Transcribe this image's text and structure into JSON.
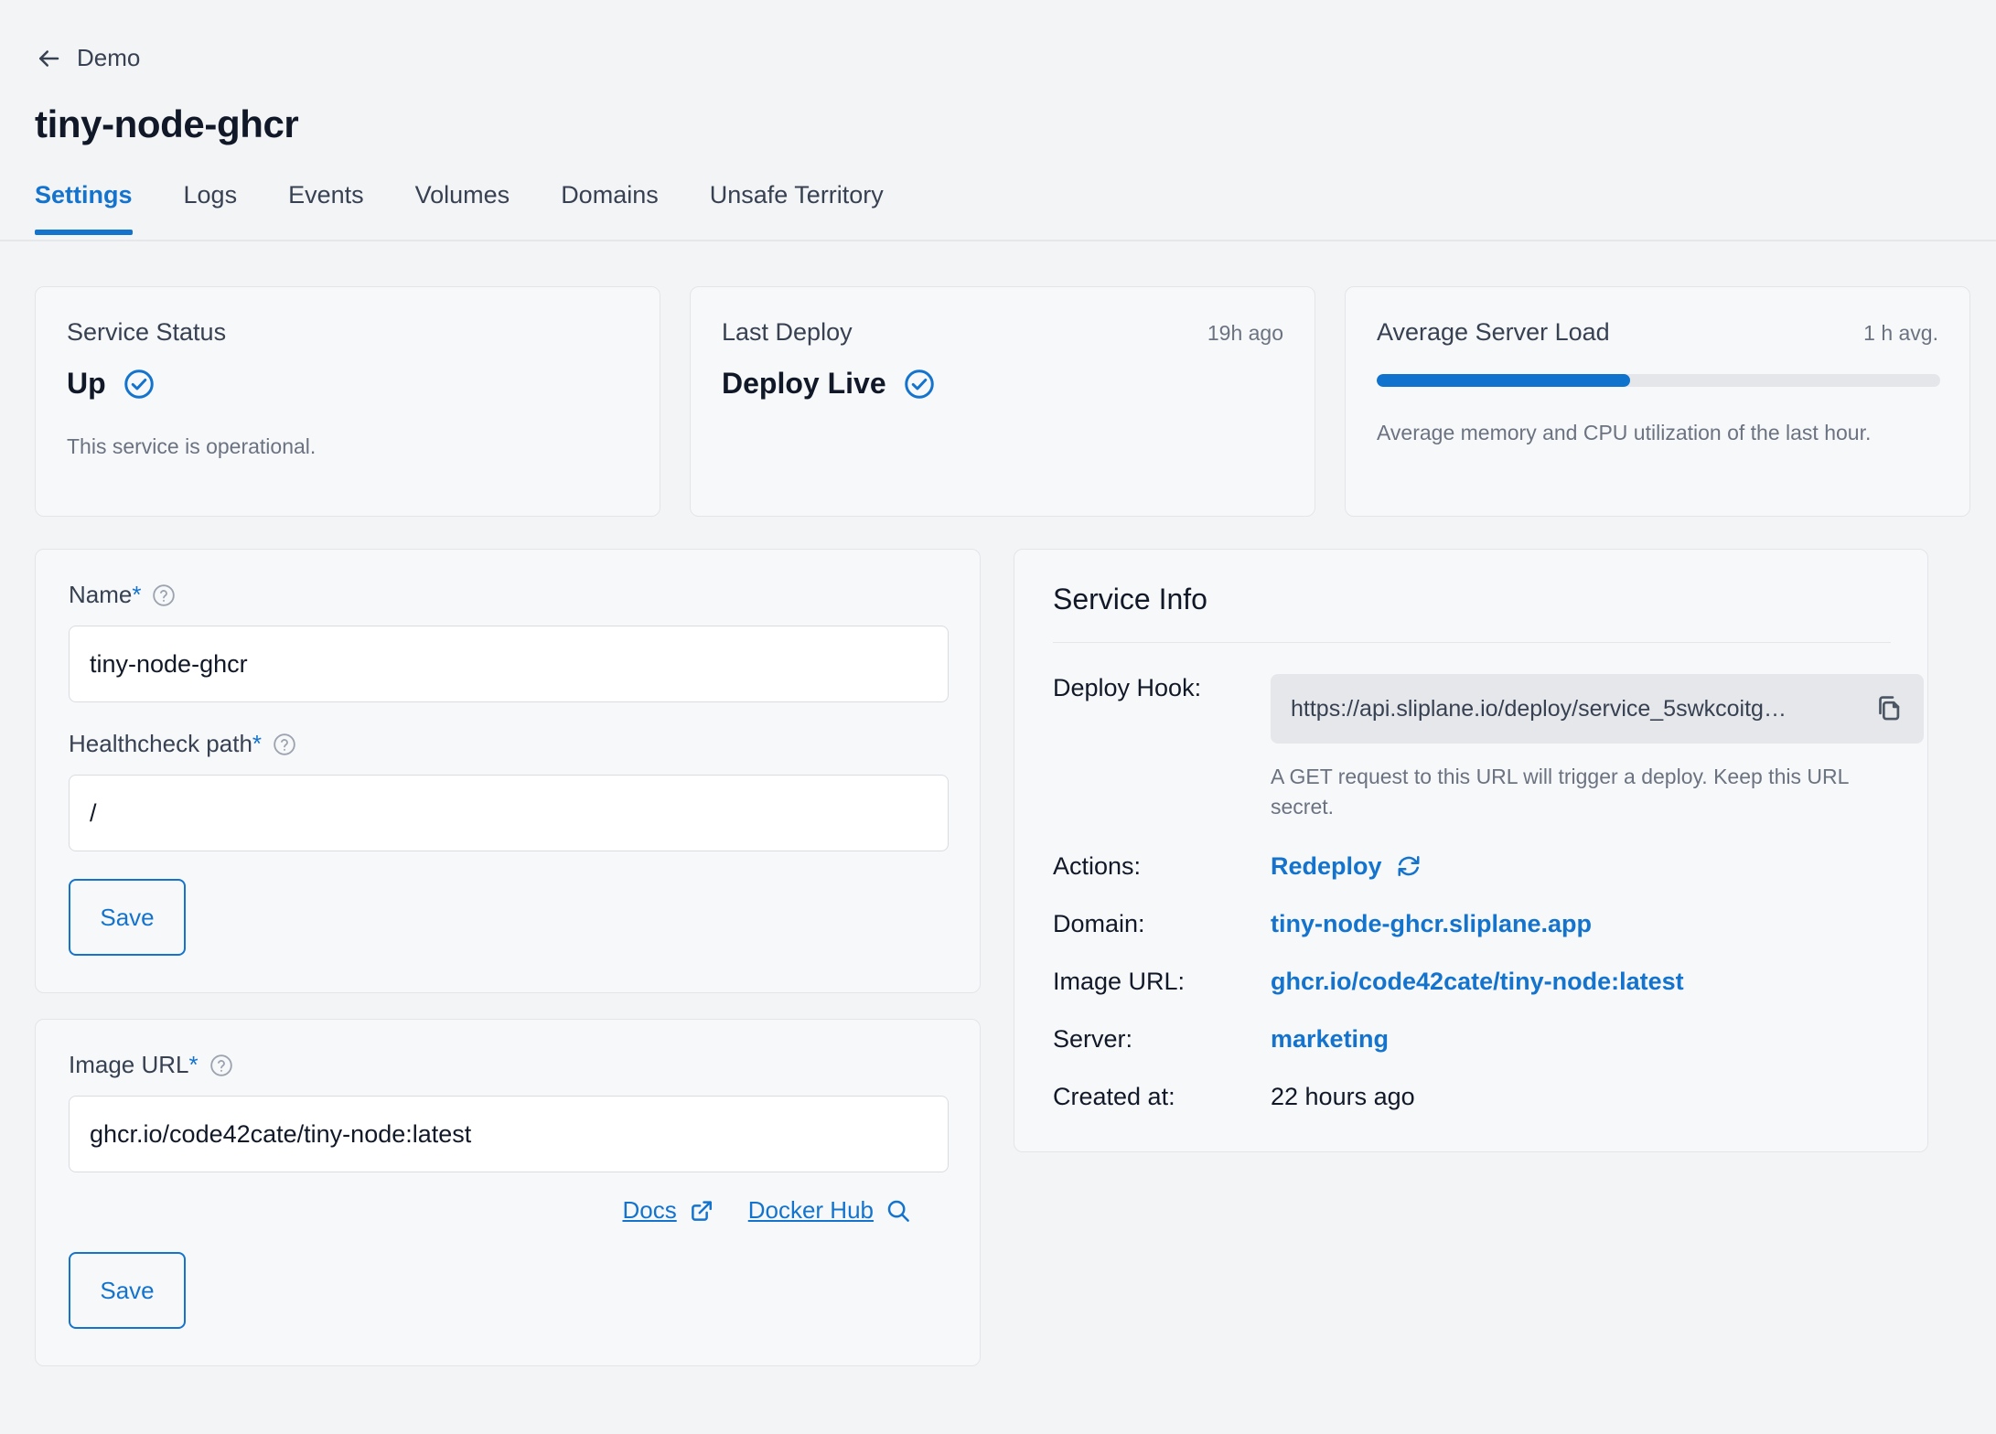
{
  "header": {
    "back_label": "Demo",
    "title": "tiny-node-ghcr"
  },
  "tabs": [
    {
      "label": "Settings",
      "active": true
    },
    {
      "label": "Logs",
      "active": false
    },
    {
      "label": "Events",
      "active": false
    },
    {
      "label": "Volumes",
      "active": false
    },
    {
      "label": "Domains",
      "active": false
    },
    {
      "label": "Unsafe Territory",
      "active": false
    }
  ],
  "status_cards": {
    "service_status": {
      "title": "Service Status",
      "value": "Up",
      "description": "This service is operational."
    },
    "last_deploy": {
      "title": "Last Deploy",
      "meta": "19h ago",
      "value": "Deploy Live"
    },
    "server_load": {
      "title": "Average Server Load",
      "meta": "1 h avg.",
      "progress_percent": 45,
      "description": "Average memory and CPU utilization of the last hour."
    }
  },
  "settings_form": {
    "name": {
      "label": "Name",
      "required_marker": "*",
      "value": "tiny-node-ghcr"
    },
    "healthcheck": {
      "label": "Healthcheck path",
      "required_marker": "*",
      "value": "/"
    },
    "save_label": "Save"
  },
  "image_form": {
    "image_url": {
      "label": "Image URL",
      "required_marker": "*",
      "value": "ghcr.io/code42cate/tiny-node:latest"
    },
    "docs_label": "Docs",
    "docker_hub_label": "Docker Hub",
    "save_label": "Save"
  },
  "service_info": {
    "title": "Service Info",
    "deploy_hook": {
      "key": "Deploy Hook:",
      "url": "https://api.sliplane.io/deploy/service_5swkcoitg…",
      "note": "A GET request to this URL will trigger a deploy. Keep this URL secret."
    },
    "actions": {
      "key": "Actions:",
      "redeploy_label": "Redeploy"
    },
    "domain": {
      "key": "Domain:",
      "value": "tiny-node-ghcr.sliplane.app"
    },
    "image_url": {
      "key": "Image URL:",
      "value": "ghcr.io/code42cate/tiny-node:latest"
    },
    "server": {
      "key": "Server:",
      "value": "marketing"
    },
    "created_at": {
      "key": "Created at:",
      "value": "22 hours ago"
    }
  },
  "colors": {
    "accent": "#1473cc",
    "page_bg": "#f3f4f6",
    "card_bg": "#f7f8fa",
    "border": "#e3e5e9"
  }
}
